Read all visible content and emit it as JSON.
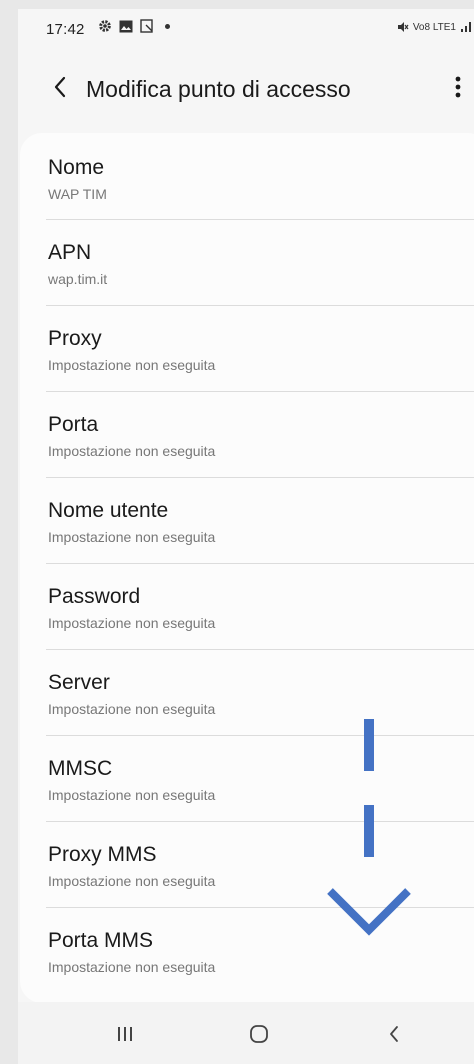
{
  "status_bar": {
    "time": "17:42",
    "right_text": "Vo8 LTE1"
  },
  "app_bar": {
    "title": "Modifica punto di accesso",
    "back_icon": "chevron-left-icon",
    "menu_icon": "more-vertical-icon"
  },
  "fields": [
    {
      "label": "Nome",
      "value": "WAP TIM"
    },
    {
      "label": "APN",
      "value": "wap.tim.it"
    },
    {
      "label": "Proxy",
      "value": "Impostazione non eseguita"
    },
    {
      "label": "Porta",
      "value": "Impostazione non eseguita"
    },
    {
      "label": "Nome utente",
      "value": "Impostazione non eseguita"
    },
    {
      "label": "Password",
      "value": "Impostazione non eseguita"
    },
    {
      "label": "Server",
      "value": "Impostazione non eseguita"
    },
    {
      "label": "MMSC",
      "value": "Impostazione non eseguita"
    },
    {
      "label": "Proxy MMS",
      "value": "Impostazione non eseguita"
    },
    {
      "label": "Porta MMS",
      "value": "Impostazione non eseguita"
    }
  ],
  "annotation": {
    "type": "scroll-down-arrow",
    "color": "#4472c4"
  },
  "nav_bar": {
    "recents_icon": "recents-icon",
    "home_icon": "home-icon",
    "back_icon": "back-icon"
  }
}
